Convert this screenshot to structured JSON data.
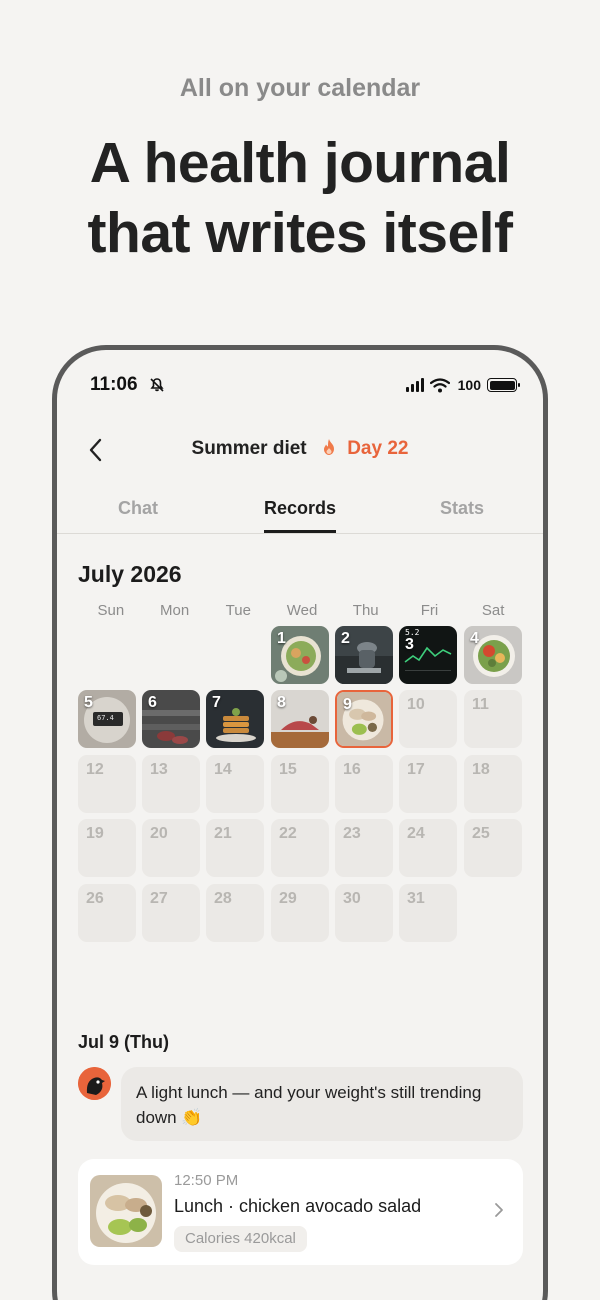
{
  "hero": {
    "subtitle": "All on your calendar",
    "title_line1": "A health journal",
    "title_line2": "that writes itself"
  },
  "status_bar": {
    "time": "11:06",
    "battery": "100"
  },
  "nav": {
    "title": "Summer diet",
    "streak": "Day 22"
  },
  "tabs": [
    {
      "label": "Chat",
      "active": false
    },
    {
      "label": "Records",
      "active": true
    },
    {
      "label": "Stats",
      "active": false
    }
  ],
  "calendar": {
    "month": "July 2026",
    "weekdays": [
      "Sun",
      "Mon",
      "Tue",
      "Wed",
      "Thu",
      "Fri",
      "Sat"
    ],
    "days": [
      "1",
      "2",
      "3",
      "4",
      "5",
      "6",
      "7",
      "8",
      "9",
      "10",
      "11",
      "12",
      "13",
      "14",
      "15",
      "16",
      "17",
      "18",
      "19",
      "20",
      "21",
      "22",
      "23",
      "24",
      "25",
      "26",
      "27",
      "28",
      "29",
      "30",
      "31"
    ],
    "selected_day": "9",
    "scale_reading": "67.4",
    "watch_reading": "5.2"
  },
  "detail": {
    "date": "Jul 9 (Thu)",
    "message": "A light lunch — and your weight's still trending down 👏",
    "entry": {
      "time": "12:50 PM",
      "title": "Lunch · chicken avocado salad",
      "tag": "Calories 420kcal"
    }
  },
  "colors": {
    "accent": "#e8643b",
    "background": "#f5f4f2",
    "cell": "#ebe9e6"
  }
}
